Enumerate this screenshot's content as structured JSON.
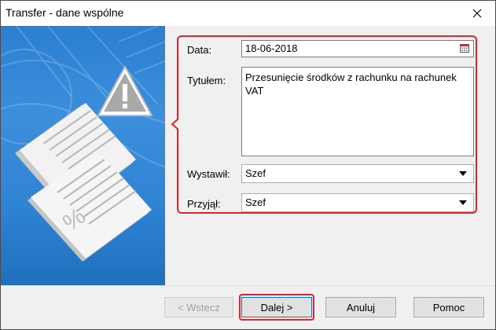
{
  "window": {
    "title": "Transfer - dane wspólne"
  },
  "form": {
    "date_label": "Data:",
    "date_value": "18-06-2018",
    "title_label": "Tytułem:",
    "title_value": "Przesunięcie środków z rachunku na rachunek VAT",
    "issued_label": "Wystawił:",
    "issued_value": "Szef",
    "received_label": "Przyjął:",
    "received_value": "Szef"
  },
  "buttons": {
    "back": "< Wstecz",
    "next": "Dalej >",
    "cancel": "Anuluj",
    "help": "Pomoc"
  },
  "colors": {
    "highlight": "#e0242c",
    "panel": "#2b7fd1",
    "focus": "#0078d7"
  },
  "icons": {
    "close": "close-icon",
    "calendar": "calendar-icon",
    "dropdown": "chevron-down-icon",
    "wizard": "warning-documents-illustration"
  }
}
